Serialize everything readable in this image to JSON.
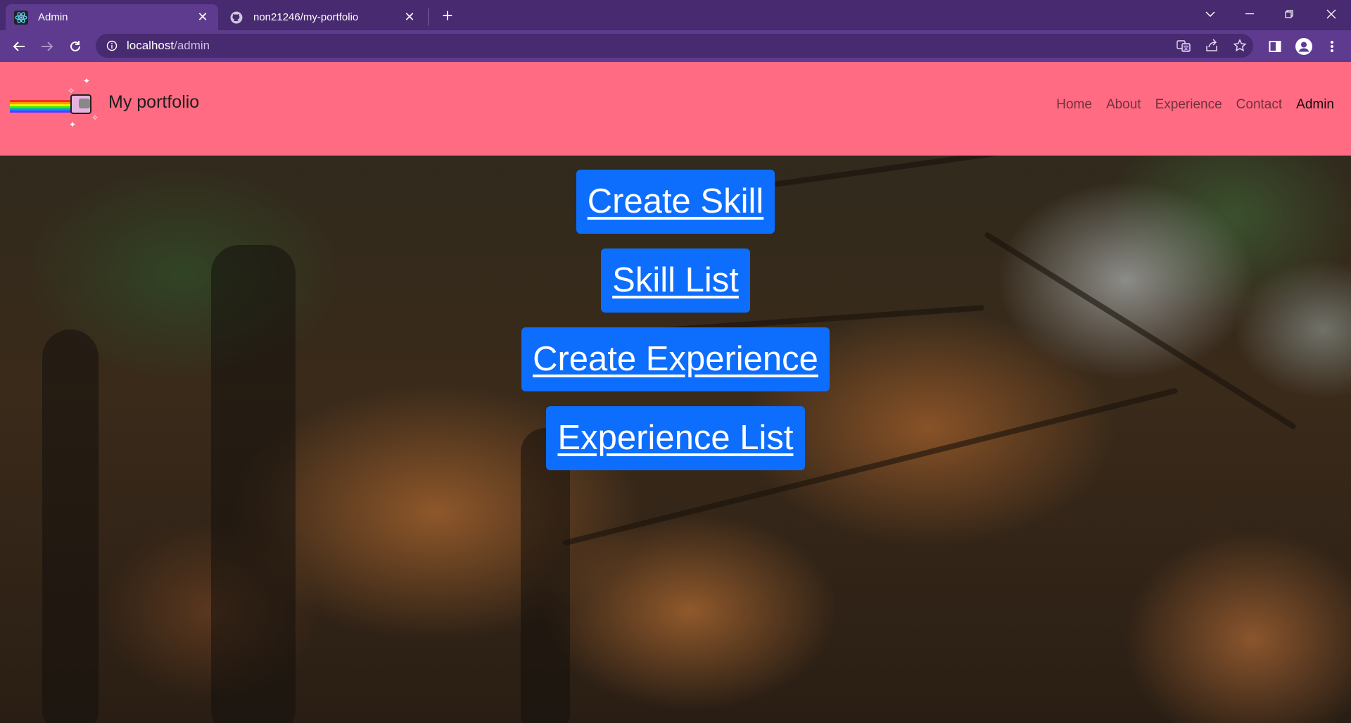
{
  "browser": {
    "tabs": [
      {
        "title": "Admin",
        "icon": "react-icon",
        "active": true
      },
      {
        "title": "non21246/my-portfolio",
        "icon": "github-icon",
        "active": false
      }
    ],
    "address": {
      "host": "localhost",
      "path": "/admin"
    }
  },
  "site": {
    "brand": "My portfolio",
    "nav": [
      {
        "label": "Home",
        "active": false
      },
      {
        "label": "About",
        "active": false
      },
      {
        "label": "Experience",
        "active": false
      },
      {
        "label": "Contact",
        "active": false
      },
      {
        "label": "Admin",
        "active": true
      }
    ]
  },
  "admin": {
    "buttons": [
      {
        "label": "Create Skill"
      },
      {
        "label": "Skill List"
      },
      {
        "label": "Create Experience"
      },
      {
        "label": "Experience List"
      }
    ]
  },
  "colors": {
    "navbar": "#ff6b82",
    "button": "#0d6efd",
    "browser_frame": "#472a6f",
    "browser_toolbar": "#5e3b8e"
  }
}
